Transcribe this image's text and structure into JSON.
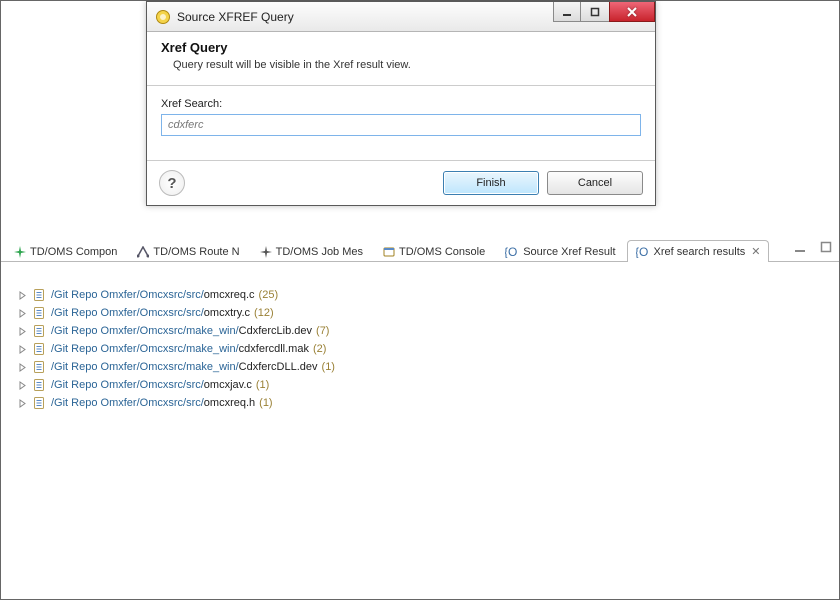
{
  "dialog": {
    "title": "Source XFREF Query",
    "header_title": "Xref Query",
    "header_sub": "Query result will be visible in the Xref result view.",
    "search_label": "Xref Search:",
    "search_value": "cdxferc",
    "help_symbol": "?",
    "finish": "Finish",
    "cancel": "Cancel"
  },
  "tabs": [
    {
      "label": "TD/OMS Compon"
    },
    {
      "label": "TD/OMS Route N"
    },
    {
      "label": "TD/OMS Job Mes"
    },
    {
      "label": "TD/OMS Console"
    },
    {
      "label": "Source Xref Result"
    },
    {
      "label": "Xref search results",
      "active": true,
      "closeGlyph": "✕"
    }
  ],
  "results": [
    {
      "path": "/Git Repo Omxfer/Omcxsrc/src/",
      "file": "omcxreq.c",
      "count": "(25)"
    },
    {
      "path": "/Git Repo Omxfer/Omcxsrc/src/",
      "file": "omcxtry.c",
      "count": "(12)"
    },
    {
      "path": "/Git Repo Omxfer/Omcxsrc/make_win/",
      "file": "CdxfercLib.dev",
      "count": "(7)"
    },
    {
      "path": "/Git Repo Omxfer/Omcxsrc/make_win/",
      "file": "cdxfercdll.mak",
      "count": "(2)"
    },
    {
      "path": "/Git Repo Omxfer/Omcxsrc/make_win/",
      "file": "CdxfercDLL.dev",
      "count": "(1)"
    },
    {
      "path": "/Git Repo Omxfer/Omcxsrc/src/",
      "file": "omcxjav.c",
      "count": "(1)"
    },
    {
      "path": "/Git Repo Omxfer/Omcxsrc/src/",
      "file": "omcxreq.h",
      "count": "(1)"
    }
  ]
}
